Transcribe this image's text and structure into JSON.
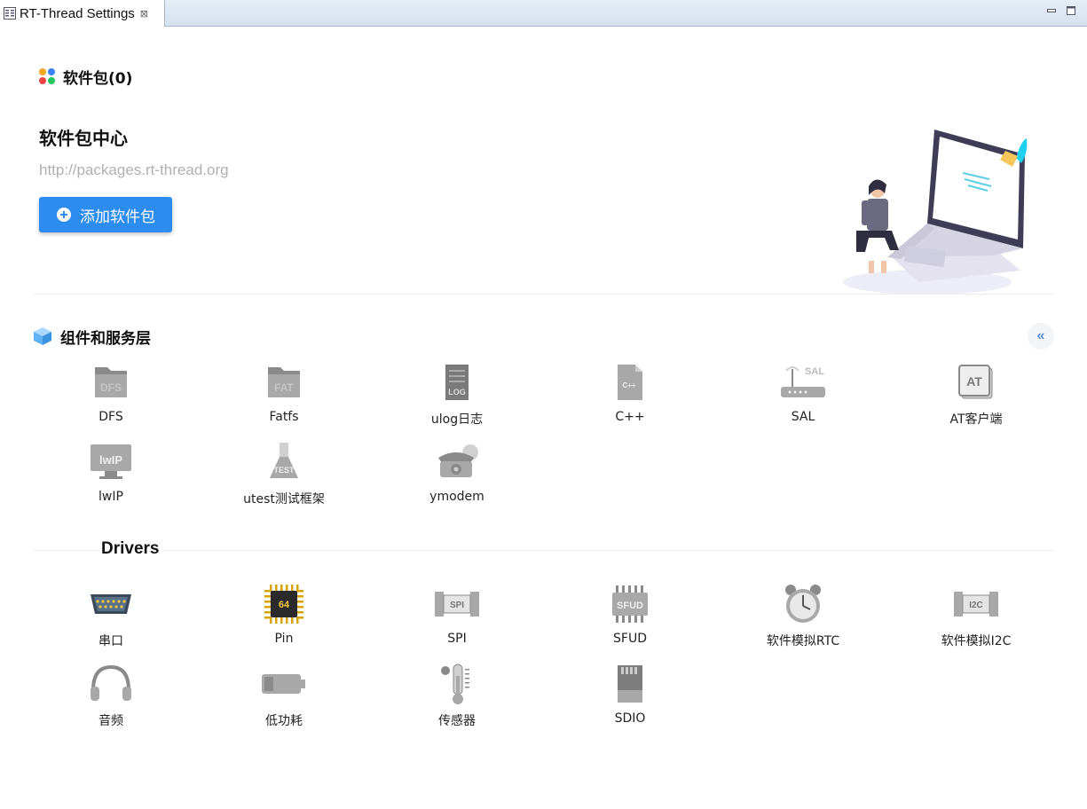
{
  "tab": {
    "title": "RT-Thread Settings",
    "close": "⊠"
  },
  "packages": {
    "header": "软件包(0)",
    "center_title": "软件包中心",
    "center_url": "http://packages.rt-thread.org",
    "add_button": "添加软件包"
  },
  "components": {
    "header": "组件和服务层",
    "collapse": "«",
    "items": [
      {
        "label": "DFS",
        "icon": "folder-dfs-icon",
        "badge": "DFS"
      },
      {
        "label": "Fatfs",
        "icon": "folder-fat-icon",
        "badge": "FAT"
      },
      {
        "label": "ulog日志",
        "icon": "log-file-icon",
        "badge": "LOG"
      },
      {
        "label": "C++",
        "icon": "cpp-file-icon",
        "badge": "C++"
      },
      {
        "label": "SAL",
        "icon": "router-sal-icon",
        "badge": "SAL"
      },
      {
        "label": "AT客户端",
        "icon": "at-command-icon",
        "badge": "AT"
      },
      {
        "label": "lwIP",
        "icon": "lwip-monitor-icon",
        "badge": "lwIP"
      },
      {
        "label": "utest测试框架",
        "icon": "test-flask-icon",
        "badge": "TEST"
      },
      {
        "label": "ymodem",
        "icon": "telephone-icon",
        "badge": ""
      }
    ]
  },
  "drivers": {
    "header": "Drivers",
    "items": [
      {
        "label": "串口",
        "icon": "serial-port-icon",
        "badge": ""
      },
      {
        "label": "Pin",
        "icon": "chip-pin-icon",
        "badge": "64"
      },
      {
        "label": "SPI",
        "icon": "spi-chip-icon",
        "badge": "SPI"
      },
      {
        "label": "SFUD",
        "icon": "sfud-chip-icon",
        "badge": "SFUD"
      },
      {
        "label": "软件模拟RTC",
        "icon": "alarm-clock-icon",
        "badge": ""
      },
      {
        "label": "软件模拟I2C",
        "icon": "i2c-chip-icon",
        "badge": "I2C"
      },
      {
        "label": "音频",
        "icon": "headphones-icon",
        "badge": ""
      },
      {
        "label": "低功耗",
        "icon": "battery-low-icon",
        "badge": ""
      },
      {
        "label": "传感器",
        "icon": "thermometer-icon",
        "badge": ""
      },
      {
        "label": "SDIO",
        "icon": "sd-card-icon",
        "badge": ""
      }
    ]
  },
  "colors": {
    "accent": "#2d8cf0",
    "url_gray": "#b0b0b0",
    "icon_gray": "#9a9a9a"
  }
}
